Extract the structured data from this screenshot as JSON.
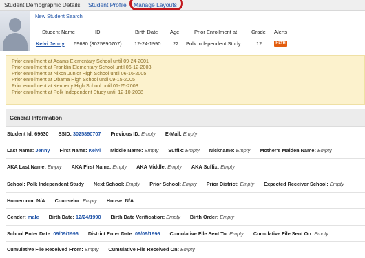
{
  "tabs": [
    {
      "label": "Student Demographic Details"
    },
    {
      "label": "Student Profile"
    },
    {
      "label": "Manage Layouts"
    }
  ],
  "new_search_link": "New Student Search",
  "summary": {
    "headers": [
      "Student Name",
      "ID",
      "Birth Date",
      "Age",
      "Prior Enrollment at",
      "Grade",
      "Alerts"
    ],
    "student_name": "Kelvi Jenny",
    "id": "69630 (3025890707)",
    "birth_date": "12-24-1990",
    "age": "22",
    "prior_enrollment": "Polk Independent Study",
    "grade": "12",
    "alert_badge": "HLTH"
  },
  "prior_enrollments": [
    "Prior enrollment at Adams Elementary School until 09-24-2001",
    "Prior enrollment at Franklin Elementary School until 06-12-2003",
    "Prior enrollment at Nixon Junior High School until 06-16-2005",
    "Prior enrollment at Obama High School until 09-15-2005",
    "Prior enrollment at Kennedy High School until 01-25-2008",
    "Prior enrollment at Polk Independent Study until 12-10-2008"
  ],
  "section_title": "General Information",
  "rows": [
    [
      {
        "label": "Student Id:",
        "value": "69630",
        "style": "plain"
      },
      {
        "label": "SSID:",
        "value": "3025890707",
        "style": "link"
      },
      {
        "label": "Previous ID:",
        "value": "Empty",
        "style": "empty"
      },
      {
        "label": "E-Mail:",
        "value": "Empty",
        "style": "empty"
      }
    ],
    [
      {
        "label": "Last Name:",
        "value": "Jenny",
        "style": "link"
      },
      {
        "label": "First Name:",
        "value": "Kelvi",
        "style": "link"
      },
      {
        "label": "Middle Name:",
        "value": "Empty",
        "style": "empty"
      },
      {
        "label": "Suffix:",
        "value": "Empty",
        "style": "empty"
      },
      {
        "label": "Nickname:",
        "value": "Empty",
        "style": "empty"
      },
      {
        "label": "Mother's Maiden Name:",
        "value": "Empty",
        "style": "empty"
      }
    ],
    [
      {
        "label": "AKA Last Name:",
        "value": "Empty",
        "style": "empty"
      },
      {
        "label": "AKA First Name:",
        "value": "Empty",
        "style": "empty"
      },
      {
        "label": "AKA Middle:",
        "value": "Empty",
        "style": "empty"
      },
      {
        "label": "AKA Suffix:",
        "value": "Empty",
        "style": "empty"
      }
    ],
    [
      {
        "label": "School:",
        "value": "Polk Independent Study",
        "style": "plain"
      },
      {
        "label": "Next School:",
        "value": "Empty",
        "style": "empty"
      },
      {
        "label": "Prior School:",
        "value": "Empty",
        "style": "empty"
      },
      {
        "label": "Prior District:",
        "value": "Empty",
        "style": "empty"
      },
      {
        "label": "Expected Receiver School:",
        "value": "Empty",
        "style": "empty"
      }
    ],
    [
      {
        "label": "Homeroom:",
        "value": "N/A",
        "style": "plain"
      },
      {
        "label": "Counselor:",
        "value": "Empty",
        "style": "empty"
      },
      {
        "label": "House:",
        "value": "N/A",
        "style": "plain"
      }
    ],
    [
      {
        "label": "Gender:",
        "value": "male",
        "style": "link"
      },
      {
        "label": "Birth Date:",
        "value": "12/24/1990",
        "style": "link"
      },
      {
        "label": "Birth Date Verification:",
        "value": "Empty",
        "style": "empty"
      },
      {
        "label": "Birth Order:",
        "value": "Empty",
        "style": "empty"
      }
    ],
    [
      {
        "label": "School Enter Date:",
        "value": "09/09/1996",
        "style": "link"
      },
      {
        "label": "District Enter Date:",
        "value": "09/09/1996",
        "style": "link"
      },
      {
        "label": "Cumulative File Sent To:",
        "value": "Empty",
        "style": "empty"
      },
      {
        "label": "Cumulative File Sent On:",
        "value": "Empty",
        "style": "empty"
      }
    ],
    [
      {
        "label": "Cumulative File Received From:",
        "value": "Empty",
        "style": "empty"
      },
      {
        "label": "Cumulative File Received On:",
        "value": "Empty",
        "style": "empty"
      }
    ]
  ]
}
